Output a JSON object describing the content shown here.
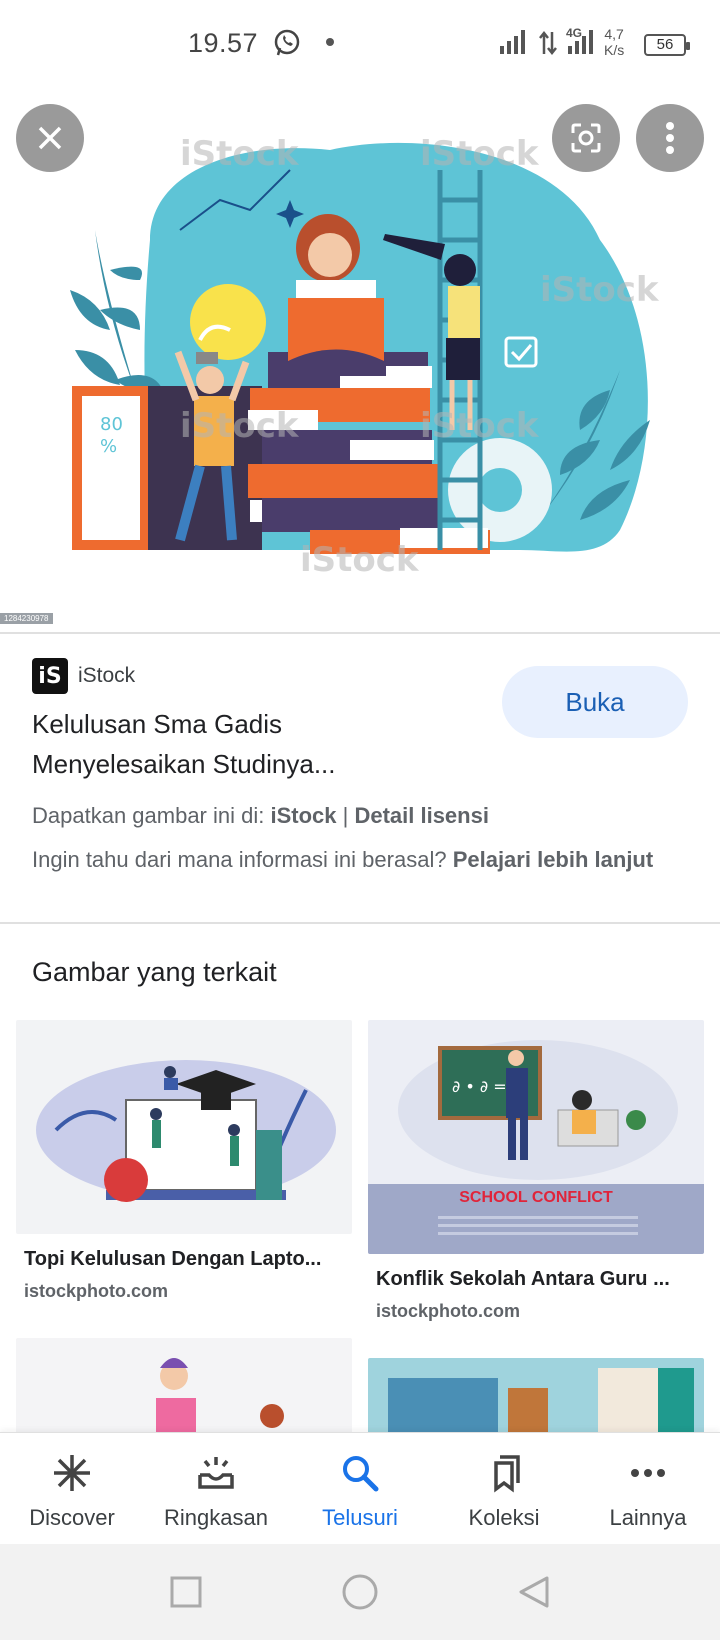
{
  "status_bar": {
    "time": "19.57",
    "network_type": "4G",
    "net_rate_value": "4,7",
    "net_rate_unit": "K/s",
    "battery": "56"
  },
  "hero": {
    "watermark_text": "iStock",
    "image_id": "1284230978",
    "close_icon": "close-icon",
    "lens_icon": "lens-icon",
    "more_icon": "more-vert-icon"
  },
  "result": {
    "source_logo_text": "iS",
    "source_name": "iStock",
    "title": "Kelulusan Sma Gadis Menyelesaikan Studinya...",
    "open_button": "Buka",
    "license_prefix": "Dapatkan gambar ini di: ",
    "license_source": "iStock",
    "license_sep": " | ",
    "license_link": "Detail lisensi",
    "learn_prefix": "Ingin tahu dari mana informasi ini berasal? ",
    "learn_link": "Pelajari lebih lanjut"
  },
  "related": {
    "heading": "Gambar yang terkait",
    "items": [
      {
        "title": "Topi Kelulusan Dengan Lapto...",
        "source": "istockphoto.com"
      },
      {
        "title": "Konflik Sekolah Antara Guru ...",
        "source": "istockphoto.com",
        "banner_text": "SCHOOL CONFLICT"
      }
    ]
  },
  "bottom_nav": {
    "items": [
      {
        "label": "Discover",
        "icon": "asterisk-icon"
      },
      {
        "label": "Ringkasan",
        "icon": "summary-icon"
      },
      {
        "label": "Telusuri",
        "icon": "search-icon"
      },
      {
        "label": "Koleksi",
        "icon": "bookmarks-icon"
      },
      {
        "label": "Lainnya",
        "icon": "more-horiz-icon"
      }
    ],
    "active_index": 2
  },
  "colors": {
    "accent": "#1a73e8",
    "open_button_bg": "#e8f0fe",
    "illustration_teal": "#5ec4d6",
    "illustration_orange": "#ee6b2f",
    "illustration_purple": "#4a3d6b"
  }
}
